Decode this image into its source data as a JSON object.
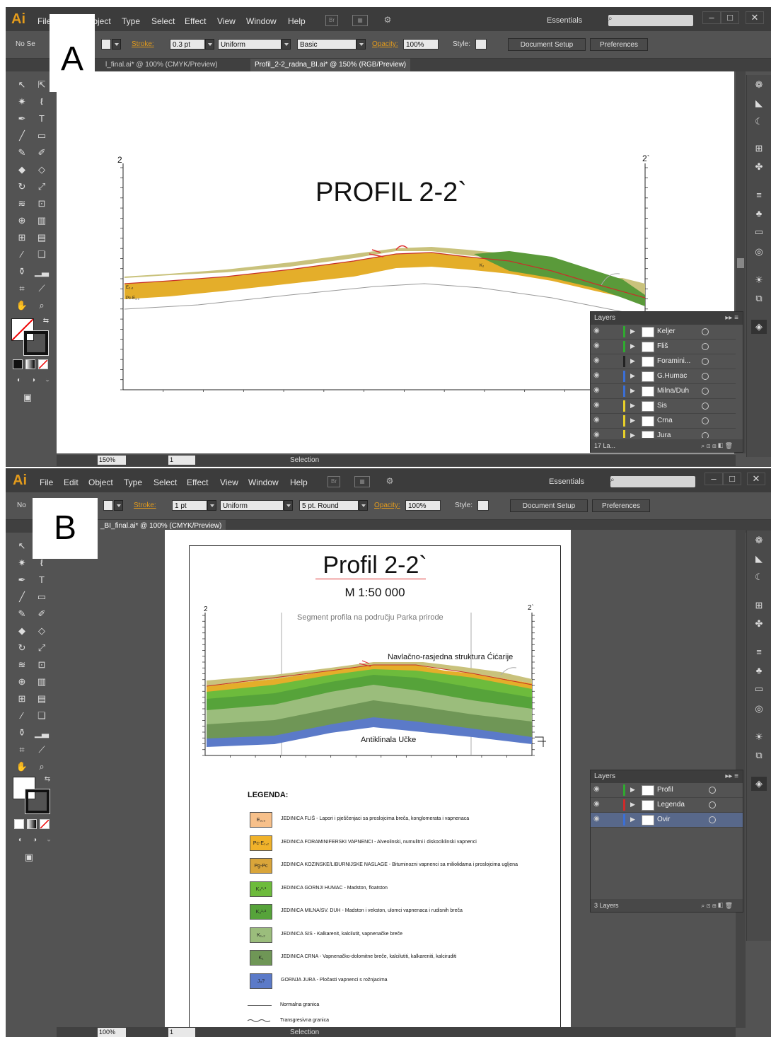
{
  "panel_labels": {
    "a": "A",
    "b": "B"
  },
  "menu": [
    "File",
    "Edit",
    "Object",
    "Type",
    "Select",
    "Effect",
    "View",
    "Window",
    "Help"
  ],
  "app": {
    "logo": "Ai",
    "bridge": "Br",
    "workspace": "Essentials",
    "min": "–",
    "max": "□",
    "close": "✕"
  },
  "winA": {
    "control": {
      "no_sel": "No Se",
      "stroke_label": "Stroke:",
      "stroke_value": "0.3 pt",
      "uniform": "Uniform",
      "brush": "Basic",
      "opacity_label": "Opacity:",
      "opacity_value": "100%",
      "style_label": "Style:",
      "doc_setup": "Document Setup",
      "preferences": "Preferences"
    },
    "tabs": [
      "l_final.ai* @ 100% (CMYK/Preview)",
      "Profil_2-2_radna_BI.ai* @ 150% (RGB/Preview)"
    ],
    "status": {
      "zoom": "150%",
      "page": "1",
      "mode": "Selection"
    },
    "canvas": {
      "title": "PROFIL 2-2`",
      "left_label": "2",
      "right_label": "2`",
      "unit_labels": [
        "E₂,₃",
        "Pc-E₁,₂",
        "K₂"
      ]
    },
    "layers": {
      "header": "Layers",
      "footer": "17 La...",
      "items": [
        {
          "name": "Keljer",
          "color": "#2faa2f"
        },
        {
          "name": "Fliš",
          "color": "#2faa2f"
        },
        {
          "name": "Foramini...",
          "color": "#222222"
        },
        {
          "name": "G.Humac",
          "color": "#3b6fd6"
        },
        {
          "name": "Milna/Duh",
          "color": "#3b6fd6"
        },
        {
          "name": "Sis",
          "color": "#e8d02a"
        },
        {
          "name": "Crna",
          "color": "#e8d02a"
        },
        {
          "name": "Jura",
          "color": "#e8d02a"
        }
      ]
    }
  },
  "winB": {
    "control": {
      "no_sel": "No",
      "stroke_label": "Stroke:",
      "stroke_value": "1 pt",
      "uniform": "Uniform",
      "brush": "5 pt. Round",
      "opacity_label": "Opacity:",
      "opacity_value": "100%",
      "style_label": "Style:",
      "doc_setup": "Document Setup",
      "preferences": "Preferences"
    },
    "tabs": [
      "_BI_final.ai* @ 100% (CMYK/Preview)"
    ],
    "status": {
      "zoom": "100%",
      "page": "1",
      "mode": "Selection"
    },
    "doc": {
      "title": "Profil 2-2`",
      "scale": "M 1:50 000",
      "segment": "Segment profila na području Parka prirode",
      "structure": "Navlačno-rasjedna struktura Ćićarije",
      "anticline": "Antiklinala Učke",
      "left_label": "2",
      "right_label": "2`",
      "legend_title": "LEGENDA:",
      "legend": [
        {
          "code": "E₂,₃",
          "color": "#f7c08a",
          "text": "JEDINICA FLIŠ - Lapori i pješčenjaci sa proslojcima breča, konglomerata i vapnenaca"
        },
        {
          "code": "Pc-E₁,₂",
          "color": "#f0b22a",
          "text": "JEDINICA FORAMINIFERSKI VAPNENCI - Alveolinski, numulitni i diskociklinski vapnenci"
        },
        {
          "code": "Pg-Pc",
          "color": "#d9a53a",
          "text": "JEDINICA KOZINSKE/LIBURNIJSKE NASLAGE - Bituminozni vapnenci sa miliolidama i proslojcima ugljena"
        },
        {
          "code": "K₂²·³",
          "color": "#6dbb3c",
          "text": "JEDINICA GORNJI HUMAC - Madston, floatston"
        },
        {
          "code": "K₂¹·²",
          "color": "#56a33a",
          "text": "JEDINICA MILNA/SV. DUH - Madston i vekston, ulomci vapnenaca i rudisnih breča"
        },
        {
          "code": "K₁,₂",
          "color": "#9bbd7c",
          "text": "JEDINICA SIS - Kalkarenit, kalcilutit, vapnenačke breče"
        },
        {
          "code": "K₁",
          "color": "#6f9656",
          "text": "JEDINICA CRNA - Vapnenačko-dolomitne breče, kalcilutiti, kalkareniti, kalciruditi"
        },
        {
          "code": "J₃?",
          "color": "#5b7ac8",
          "text": "GORNJA JURA - Pločasti vapnenci s rožnjacima"
        }
      ],
      "line_normal": "Normalna granica",
      "line_trans": "Transgresivna granica"
    },
    "layers": {
      "header": "Layers",
      "footer": "3 Layers",
      "items": [
        {
          "name": "Profil",
          "color": "#2faa2f",
          "selected": false
        },
        {
          "name": "Legenda",
          "color": "#d02a2a",
          "selected": false
        },
        {
          "name": "Ovir",
          "color": "#3b6fd6",
          "selected": true
        }
      ]
    }
  },
  "colors": {
    "accent": "#e39b1c",
    "panel": "#535353",
    "dark": "#3c3c3c",
    "green": "#5a9a3a",
    "ochre": "#e4ae2a",
    "olive": "#c9c27c",
    "blue": "#5b7ac8"
  }
}
